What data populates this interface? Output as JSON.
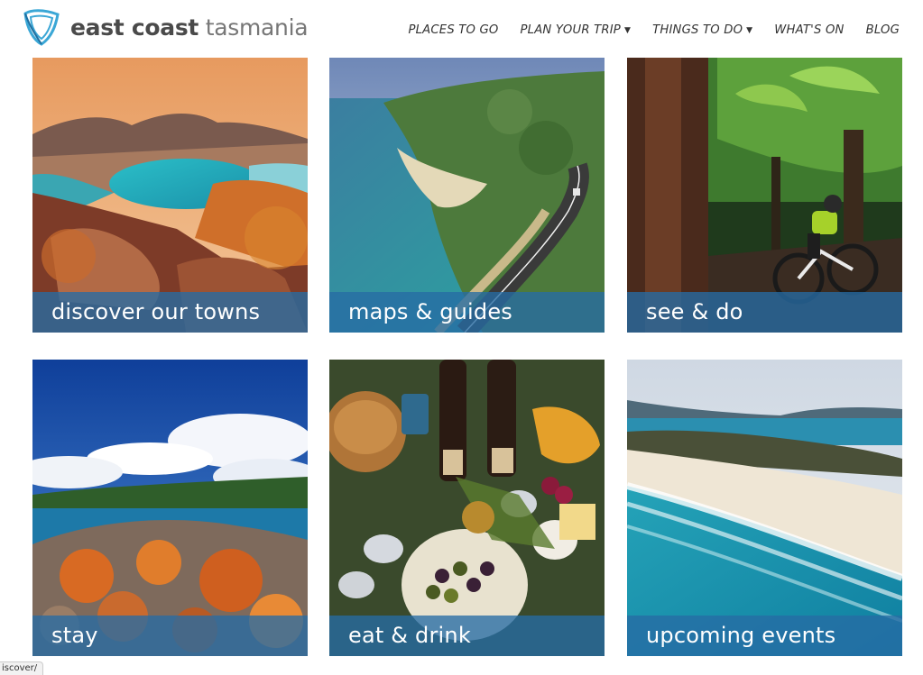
{
  "header": {
    "logo_bold": "east coast",
    "logo_light": "tasmania",
    "logo_icon": "wave-logo-icon"
  },
  "nav": {
    "items": [
      {
        "label": "PLACES TO GO",
        "dropdown": false
      },
      {
        "label": "PLAN YOUR TRIP",
        "dropdown": true
      },
      {
        "label": "THINGS TO DO",
        "dropdown": true
      },
      {
        "label": "WHAT'S ON",
        "dropdown": false
      },
      {
        "label": "BLOG",
        "dropdown": false
      }
    ]
  },
  "tiles": [
    {
      "label": "discover our towns",
      "image": "bay-sunset-photo"
    },
    {
      "label": "maps & guides",
      "image": "coastal-road-photo"
    },
    {
      "label": "see & do",
      "image": "rainforest-mountain-bike-photo"
    },
    {
      "label": "stay",
      "image": "orange-lichen-rocks-photo"
    },
    {
      "label": "eat & drink",
      "image": "wine-oysters-platter-photo"
    },
    {
      "label": "upcoming events",
      "image": "aerial-beach-photo"
    }
  ],
  "colors": {
    "label_bg": "#266ca4",
    "logo_blue": "#3ba7d6"
  },
  "status_bar": {
    "url": "iscover/"
  }
}
